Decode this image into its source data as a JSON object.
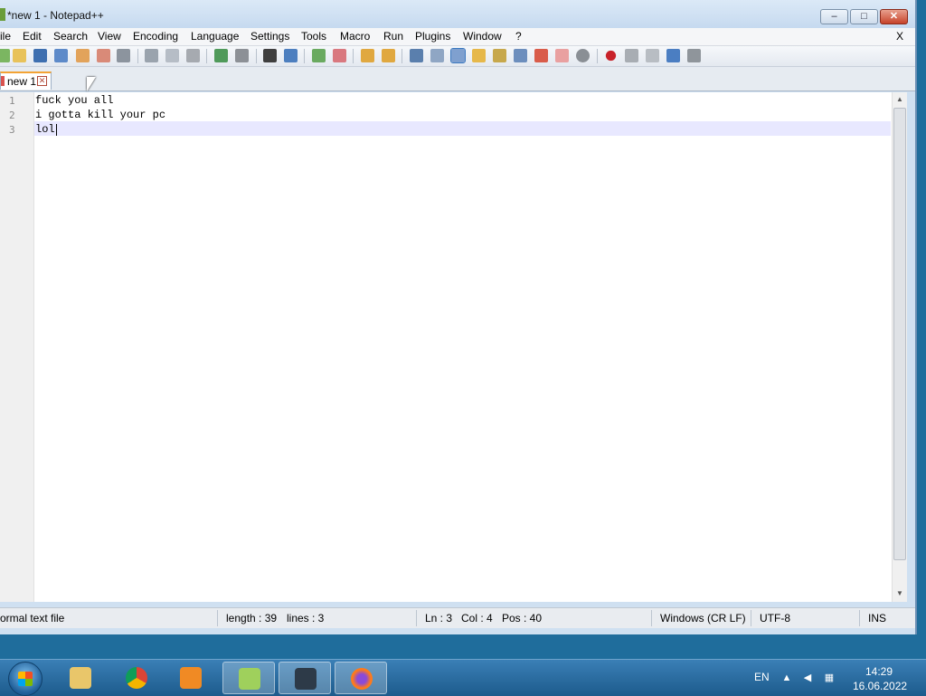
{
  "window": {
    "title": "*new 1 - Notepad++",
    "buttons": {
      "minimize": "–",
      "maximize": "□",
      "close": "✕"
    }
  },
  "menu": {
    "items": [
      "ile",
      "Edit",
      "Search",
      "View",
      "Encoding",
      "Language",
      "Settings",
      "Tools",
      "Macro",
      "Run",
      "Plugins",
      "Window",
      "?"
    ],
    "close_doc": "X"
  },
  "tabs": [
    {
      "label": "new 1",
      "close": "✕",
      "accent": "#f3a334"
    }
  ],
  "editor": {
    "lines": [
      {
        "number": "1",
        "text": "fuck you all"
      },
      {
        "number": "2",
        "text": "i gotta kill your pc"
      },
      {
        "number": "3",
        "text": "lol"
      }
    ],
    "current_line_color": "#e8e8ff"
  },
  "statusbar": {
    "file_type": "ormal text file",
    "length": "length : 39",
    "lines": "lines : 3",
    "ln": "Ln : 3",
    "col": "Col : 4",
    "pos": "Pos : 40",
    "eol": "Windows (CR LF)",
    "encoding": "UTF-8",
    "mode": "INS"
  },
  "taskbar": {
    "apps": [
      "file-explorer-icon",
      "chrome-icon",
      "media-player-icon",
      "notepadpp-icon",
      "chess-icon",
      "firefox-icon"
    ],
    "language": "EN",
    "time": "14:29",
    "date": "16.06.2022"
  },
  "toolbar_icons": [
    "new-file-icon",
    "open-file-icon",
    "save-icon",
    "save-all-icon",
    "close-icon",
    "close-all-icon",
    "print-icon",
    "cut-icon",
    "copy-icon",
    "paste-icon",
    "undo-icon",
    "redo-icon",
    "find-icon",
    "replace-icon",
    "zoom-in-icon",
    "zoom-out-icon",
    "sync-vertical-icon",
    "sync-horizontal-icon",
    "word-wrap-icon",
    "show-all-chars-icon",
    "indent-guide-icon",
    "udl-icon",
    "doc-map-icon",
    "doc-list-icon",
    "function-list-icon",
    "folder-workspace-icon",
    "monitoring-icon",
    "record-macro-icon",
    "stop-macro-icon",
    "play-macro-icon",
    "run-macro-multiple-icon",
    "save-macro-icon"
  ]
}
